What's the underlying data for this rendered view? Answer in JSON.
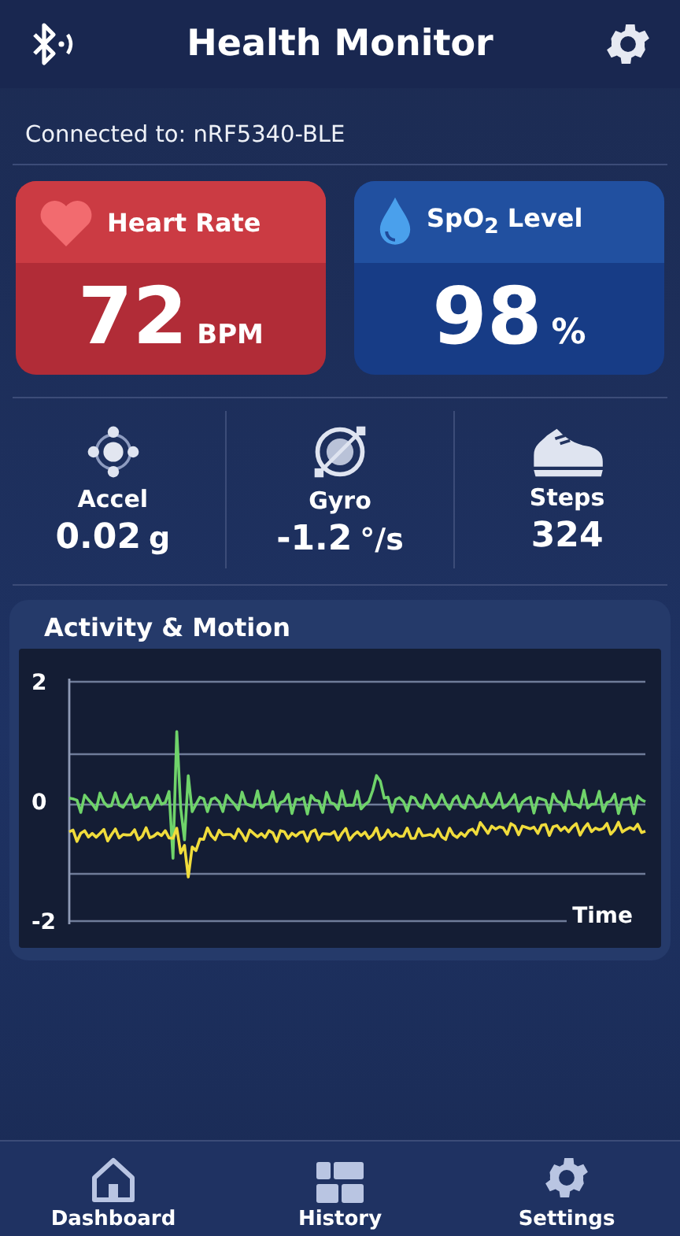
{
  "header": {
    "title": "Health Monitor"
  },
  "connection": {
    "text": "Connected to: nRF5340-BLE"
  },
  "vitals": [
    {
      "kind": "heart",
      "label": "Heart Rate",
      "value": "72",
      "unit": "BPM"
    },
    {
      "kind": "spo2",
      "label": "SpO$_{2}$ Level",
      "value": "98",
      "unit": "%"
    }
  ],
  "metrics": [
    {
      "kind": "accel",
      "label": "Accel",
      "value": "0.02",
      "unit": "g"
    },
    {
      "kind": "gyro",
      "label": "Gyro",
      "value": "-1.2",
      "unit": "°/s"
    },
    {
      "kind": "steps",
      "label": "Steps",
      "value": "324"
    }
  ],
  "activity": {
    "title": "Activity & Motion",
    "y_ticks": [
      "2",
      "0",
      "-2"
    ],
    "x_label": "Time",
    "traces": [
      {
        "kind": "spike",
        "color": "#6fd36a"
      },
      {
        "kind": "dip",
        "color": "#f0dc3c"
      }
    ]
  },
  "nav": [
    {
      "kind": "home",
      "label": "Dashboard"
    },
    {
      "kind": "grid",
      "label": "History"
    },
    {
      "kind": "gear",
      "label": "Settings"
    }
  ]
}
